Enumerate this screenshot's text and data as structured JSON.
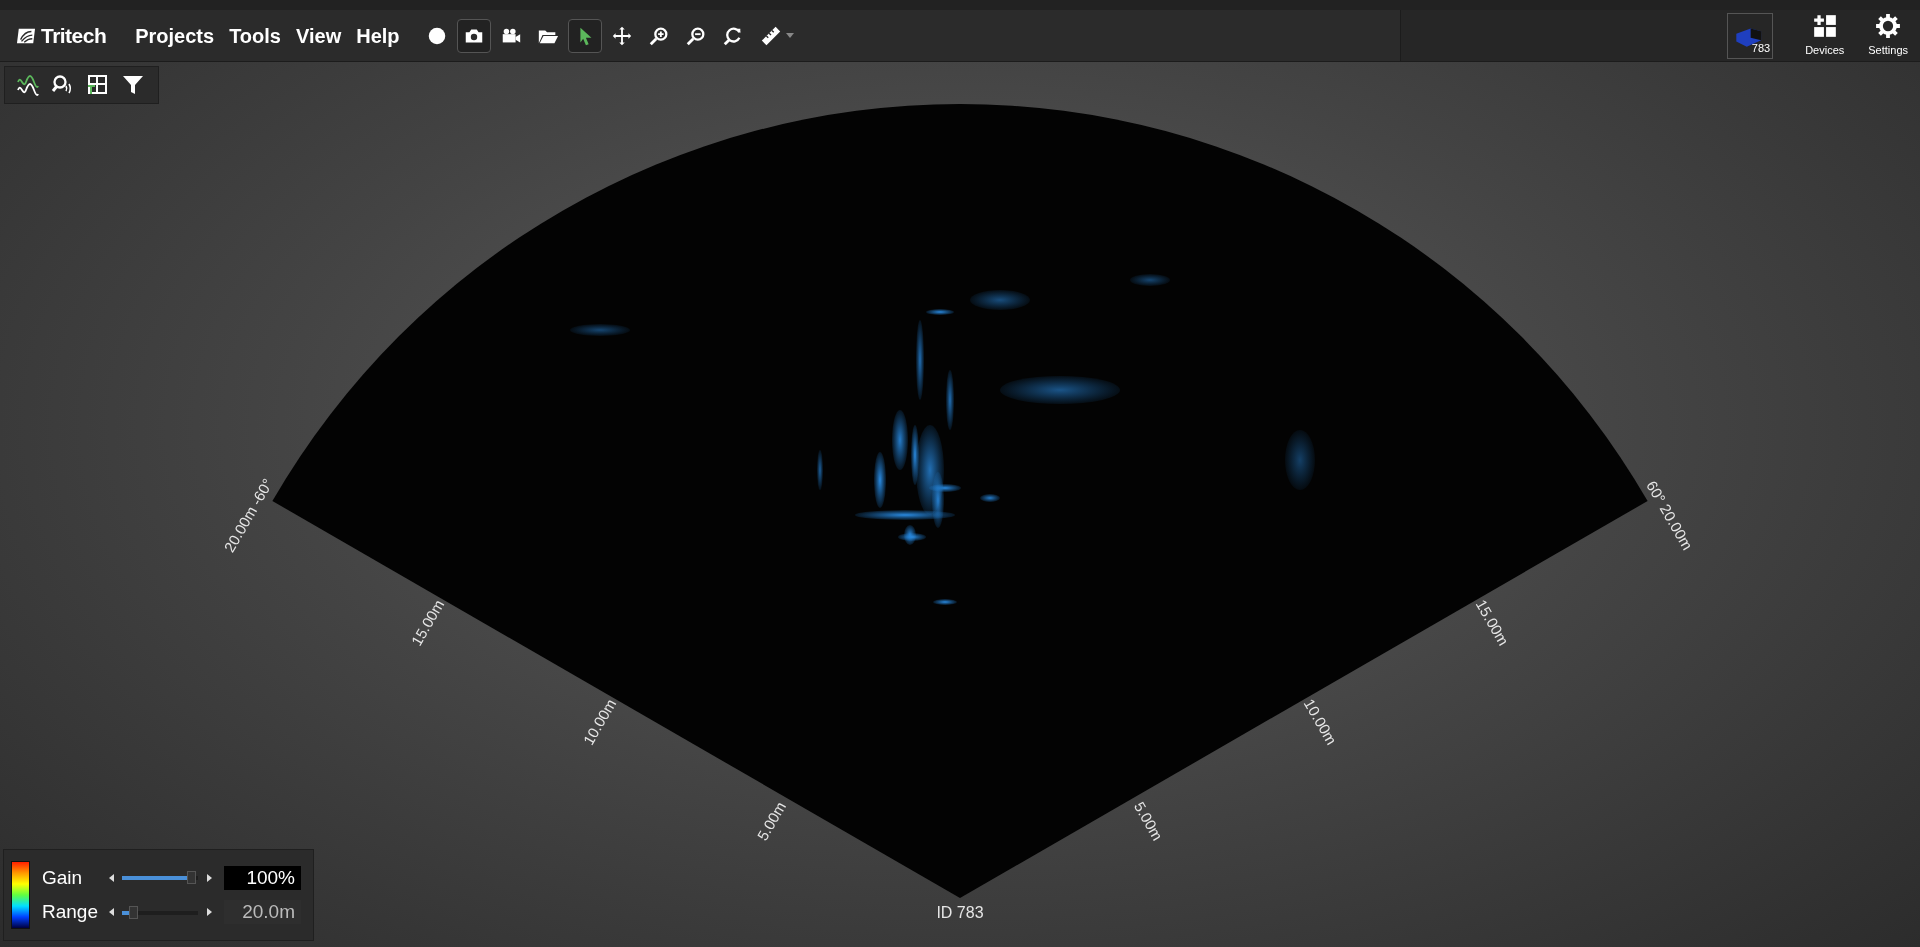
{
  "brand": "Tritech",
  "menu": [
    {
      "label": "Projects"
    },
    {
      "label": "Tools"
    },
    {
      "label": "View"
    },
    {
      "label": "Help"
    }
  ],
  "tools": [
    {
      "kind": "record",
      "selected": false
    },
    {
      "kind": "camera",
      "selected": true
    },
    {
      "kind": "video",
      "selected": false
    },
    {
      "kind": "open",
      "selected": false
    },
    {
      "kind": "pointer",
      "selected": true
    },
    {
      "kind": "pan",
      "selected": false
    },
    {
      "kind": "zoom-in",
      "selected": false
    },
    {
      "kind": "zoom-out",
      "selected": false
    },
    {
      "kind": "reset",
      "selected": false
    },
    {
      "kind": "ruler",
      "selected": false
    }
  ],
  "side_tools": [
    {
      "kind": "wave"
    },
    {
      "kind": "search-sonar"
    },
    {
      "kind": "grid"
    },
    {
      "kind": "filter"
    }
  ],
  "device": {
    "label": "783"
  },
  "right_buttons": [
    {
      "kind": "devices",
      "label": "Devices"
    },
    {
      "kind": "settings",
      "label": "Settings"
    }
  ],
  "sonar": {
    "left_labels": [
      "5.00m",
      "10.00m",
      "15.00m"
    ],
    "right_labels": [
      "5.00m",
      "10.00m",
      "15.00m"
    ],
    "left_corner": {
      "range": "20.00m",
      "angle": "-60°"
    },
    "right_corner": {
      "angle": "60°",
      "range": "20.00m"
    },
    "caption": "ID 783"
  },
  "controls": [
    {
      "label": "Gain",
      "level": 0.97,
      "value": "100%",
      "selected": true
    },
    {
      "label": "Range",
      "level": 0.1,
      "value": "20.0m",
      "selected": false
    }
  ]
}
